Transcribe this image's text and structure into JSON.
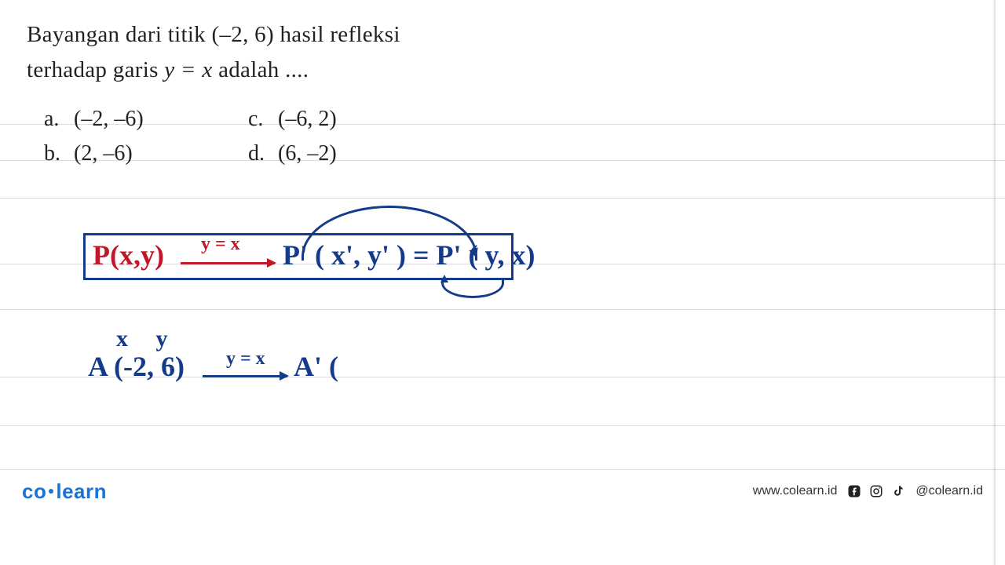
{
  "question": {
    "line1_a": "Bayangan dari titik (",
    "line1_b": "–2, 6",
    "line1_c": ") hasil refleksi",
    "line2_a": "terhadap garis ",
    "line2_var": "y = x",
    "line2_b": " adalah ...."
  },
  "options": {
    "a": {
      "label": "a.",
      "text": "(–2, –6)"
    },
    "b": {
      "label": "b.",
      "text": "(2, –6)"
    },
    "c": {
      "label": "c.",
      "text": "(–6, 2)"
    },
    "d": {
      "label": "d.",
      "text": "(6, –2)"
    }
  },
  "handwriting": {
    "formula_p1": "P(x,y)",
    "formula_yx": "y = x",
    "formula_p2": "P' ( x', y' ) = P' ( y, x)",
    "xy_label": "x y",
    "work_a": "A (-2, 6)",
    "work_yx": "y = x",
    "work_ap": "A' ("
  },
  "footer": {
    "brand_left": "co",
    "brand_right": "learn",
    "url": "www.colearn.id",
    "handle": "@colearn.id"
  },
  "icons": {
    "facebook": "facebook-icon",
    "instagram": "instagram-icon",
    "tiktok": "tiktok-icon"
  }
}
